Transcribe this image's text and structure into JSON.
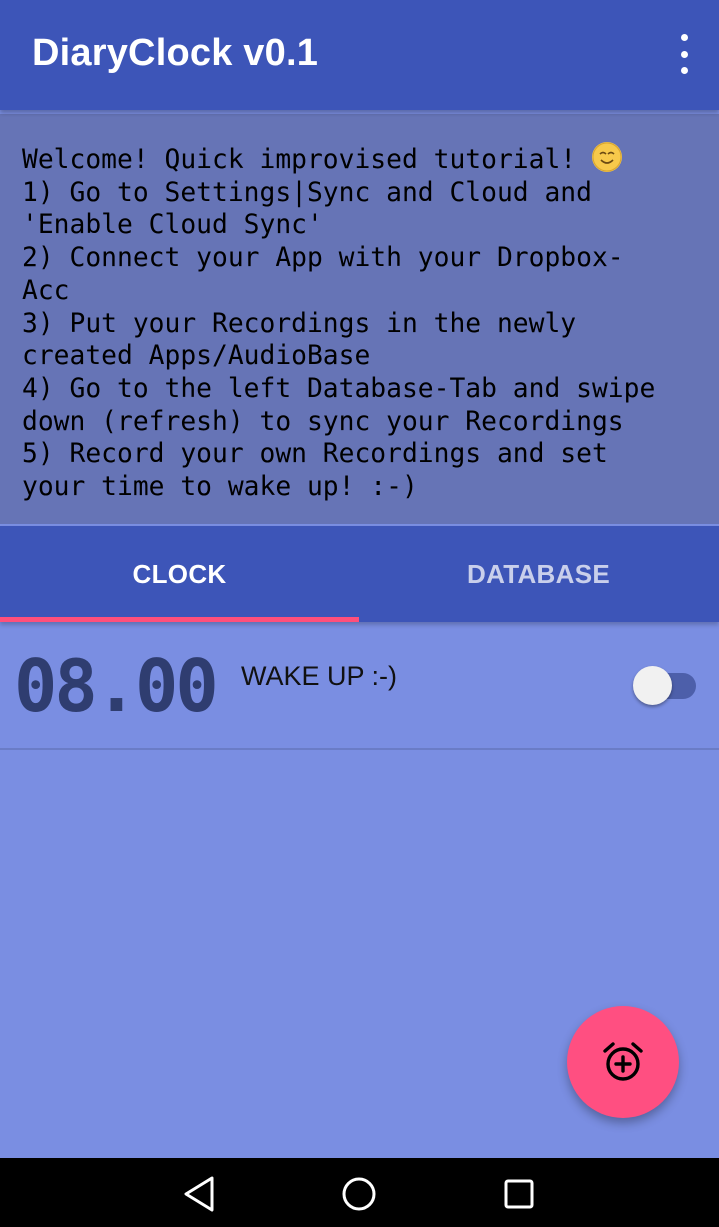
{
  "app": {
    "title": "DiaryClock v0.1",
    "menu_icon": "more-vert-icon"
  },
  "tutorial": {
    "line_1": "Welcome! Quick improvised tutorial! ",
    "emoji": "smiley-emoji-icon",
    "rest": "1) Go to Settings|Sync and Cloud and\n'Enable Cloud Sync'\n2) Connect your App with your Dropbox-\nAcc\n3) Put your Recordings in the newly\ncreated Apps/AudioBase\n4) Go to the left Database-Tab and swipe\ndown (refresh) to sync your Recordings\n5) Record your own Recordings and set\nyour time to wake up! :-)"
  },
  "tabs": [
    {
      "label": "CLOCK",
      "selected": true
    },
    {
      "label": "DATABASE",
      "selected": false
    }
  ],
  "alarms": [
    {
      "time": "08.00",
      "label": "WAKE UP :-)",
      "enabled": false
    }
  ],
  "fab": {
    "icon": "add-alarm-icon"
  },
  "navbar": {
    "icons": [
      "back-icon",
      "home-icon",
      "recents-icon"
    ]
  },
  "colors": {
    "primary": "#3d55b8",
    "accent": "#ff4f81",
    "background": "#7a8ee2"
  }
}
